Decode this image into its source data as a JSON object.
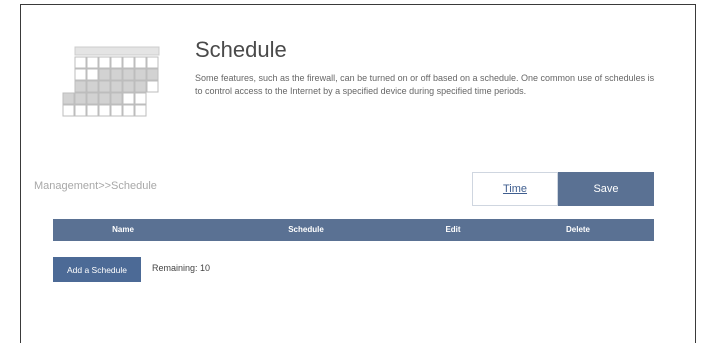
{
  "header": {
    "title": "Schedule",
    "description": "Some features, such as the firewall, can be turned on or off based on a schedule. One common use of schedules is to control access to the Internet by a specified device during specified time periods.",
    "icon": "calendar-icon"
  },
  "breadcrumb": "Management>>Schedule",
  "buttons": {
    "time_label": "Time",
    "save_label": "Save",
    "add_schedule_label": "Add a Schedule"
  },
  "table": {
    "columns": [
      "Name",
      "Schedule",
      "Edit",
      "Delete"
    ]
  },
  "remaining": {
    "label": "Remaining:",
    "value": "10"
  },
  "colors": {
    "accent": "#5a7193",
    "button_dark": "#4c6a96",
    "link": "#3f5e8f"
  }
}
